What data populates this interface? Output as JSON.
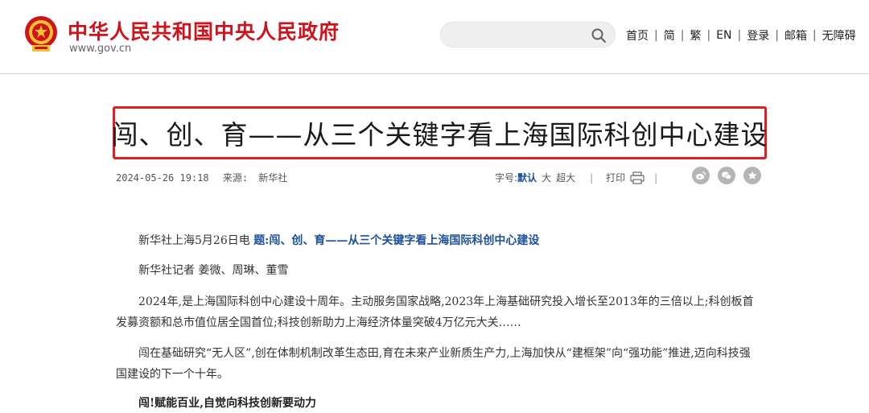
{
  "header": {
    "site_title": "中华人民共和国中央人民政府",
    "site_url": "www.gov.cn",
    "search_placeholder": "",
    "nav": [
      "首页",
      "简",
      "繁",
      "EN",
      "登录",
      "邮箱",
      "无障碍"
    ]
  },
  "article": {
    "title": "闯、创、育——从三个关键字看上海国际科创中心建设",
    "date": "2024-05-26 19:18",
    "source_label": "来源:",
    "source": "新华社",
    "font_size_label": "字号:",
    "font_sizes": [
      "默认",
      "大",
      "超大"
    ],
    "print_label": "打印",
    "share_icons": [
      "weibo-icon",
      "wechat-icon",
      "favorite-icon"
    ],
    "dateline": "新华社上海5月26日电",
    "lead_title": "题:闯、创、育——从三个关键字看上海国际科创中心建设",
    "reporters": "新华社记者 姜微、周琳、董雪",
    "paragraph1": "2024年,是上海国际科创中心建设十周年。主动服务国家战略,2023年上海基础研究投入增长至2013年的三倍以上;科创板首发募资额和总市值位居全国首位;科技创新助力上海经济体量突破4万亿元大关……",
    "paragraph2": "闯在基础研究“无人区”,创在体制机制改革生态田,育在未来产业新质生产力,上海加快从“建框架”向“强功能”推进,迈向科技强国建设的下一个十年。",
    "subheading": "闯!赋能百业,自觉向科技创新要动力"
  },
  "colors": {
    "brand_red": "#d0121b",
    "highlight_border": "#e02020",
    "link_blue": "#1c4f9c"
  }
}
